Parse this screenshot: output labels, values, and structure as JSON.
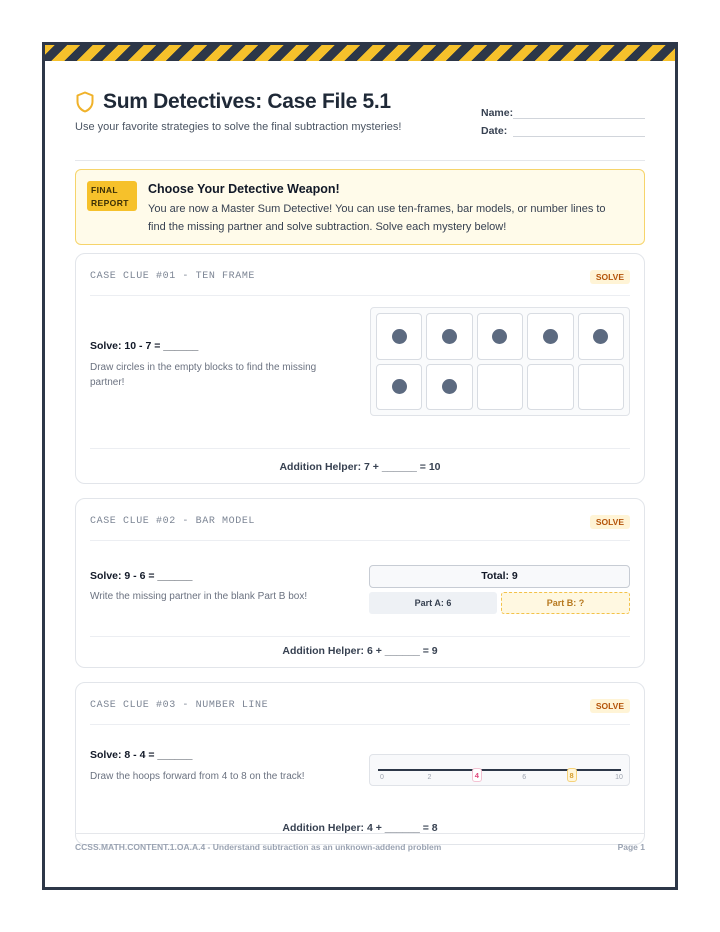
{
  "header": {
    "title": "Sum Detectives: Case File 5.1",
    "subtitle": "Use your favorite strategies to solve the final subtraction mysteries!",
    "name_label": "Name:",
    "date_label": "Date:"
  },
  "intro": {
    "badge_line1": "FINAL",
    "badge_line2": "REPORT",
    "title": "Choose Your Detective Weapon!",
    "text": "You are now a Master Sum Detective! You can use ten-frames, bar models, or number lines to find the missing partner and solve subtraction. Solve each mystery below!"
  },
  "cards": [
    {
      "clue": "CASE CLUE #01 - TEN FRAME",
      "badge": "SOLVE",
      "problem": "Solve: 10 - 7 = ______",
      "hint": "Draw circles in the empty blocks to find the missing partner!",
      "helper": "Addition Helper: 7 + ______ = 10",
      "filled_cells": 7,
      "total_cells": 10
    },
    {
      "clue": "CASE CLUE #02 - BAR MODEL",
      "badge": "SOLVE",
      "problem": "Solve: 9 - 6 = ______",
      "hint": "Write the missing partner in the blank Part B box!",
      "helper": "Addition Helper: 6 + ______ = 9",
      "total_label": "Total: 9",
      "part_a": "Part A: 6",
      "part_b": "Part B: ?"
    },
    {
      "clue": "CASE CLUE #03 - NUMBER LINE",
      "badge": "SOLVE",
      "problem": "Solve: 8 - 4 = ______",
      "hint": "Draw the hoops forward from 4 to 8 on the track!",
      "helper": "Addition Helper: 4 + ______ = 8",
      "ticks": [
        "0",
        "2",
        "4",
        "6",
        "8",
        "10"
      ],
      "start": "4",
      "end": "8"
    }
  ],
  "footer": {
    "standard": "CCSS.MATH.CONTENT.1.OA.A.4 - Understand subtraction as an unknown-addend problem",
    "page": "Page 1"
  },
  "colors": {
    "accent": "#f6c12b",
    "dark": "#2d3748",
    "start_mark": "#e0457b",
    "end_mark": "#d69e2e"
  }
}
